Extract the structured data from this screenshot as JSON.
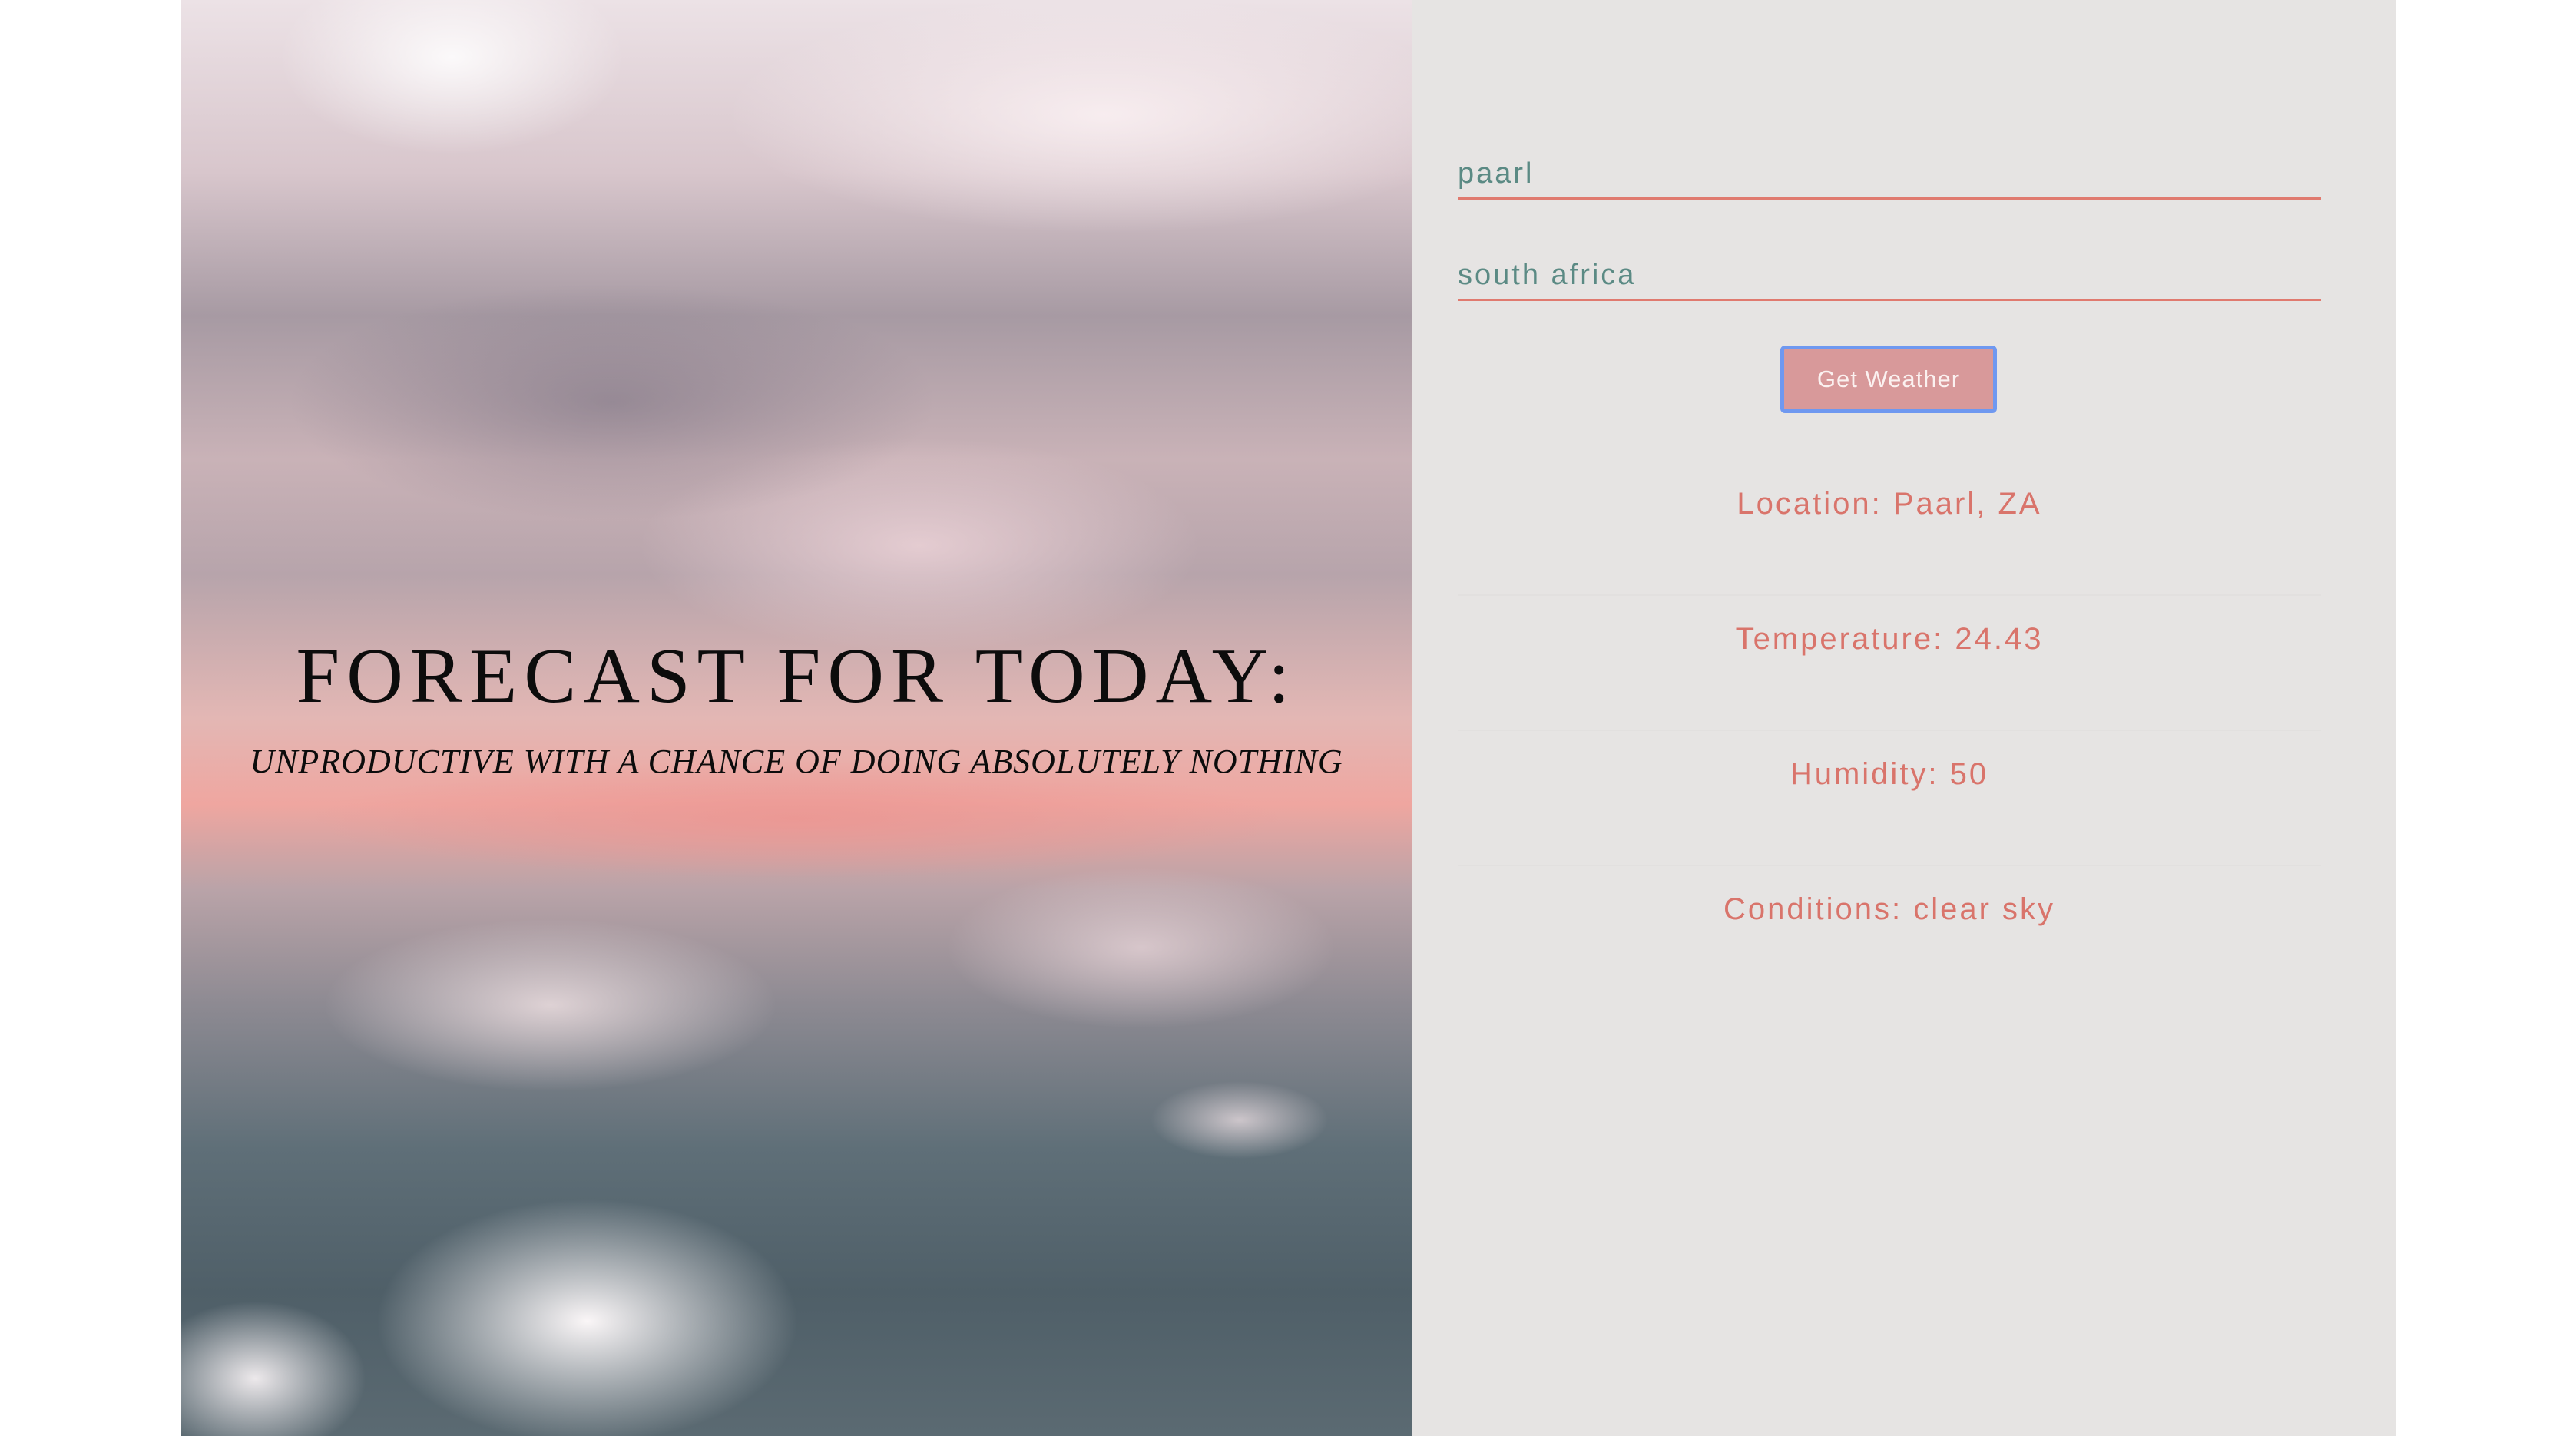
{
  "hero": {
    "title": "FORECAST FOR TODAY:",
    "subtitle": "UNPRODUCTIVE WITH A CHANCE OF DOING ABSOLUTELY NOTHING"
  },
  "form": {
    "city_value": "paarl",
    "country_value": "south africa",
    "submit_label": "Get Weather"
  },
  "results": {
    "location": "Location: Paarl, ZA",
    "temperature": "Temperature: 24.43",
    "humidity": "Humidity: 50",
    "conditions": "Conditions: clear sky"
  },
  "colors": {
    "accent": "#e07a6f",
    "result_text": "#d9746b",
    "input_text": "#5b8a84",
    "button_bg": "#d8999a",
    "button_focus_ring": "#6f98f0",
    "panel_bg": "#e6e4e3"
  }
}
